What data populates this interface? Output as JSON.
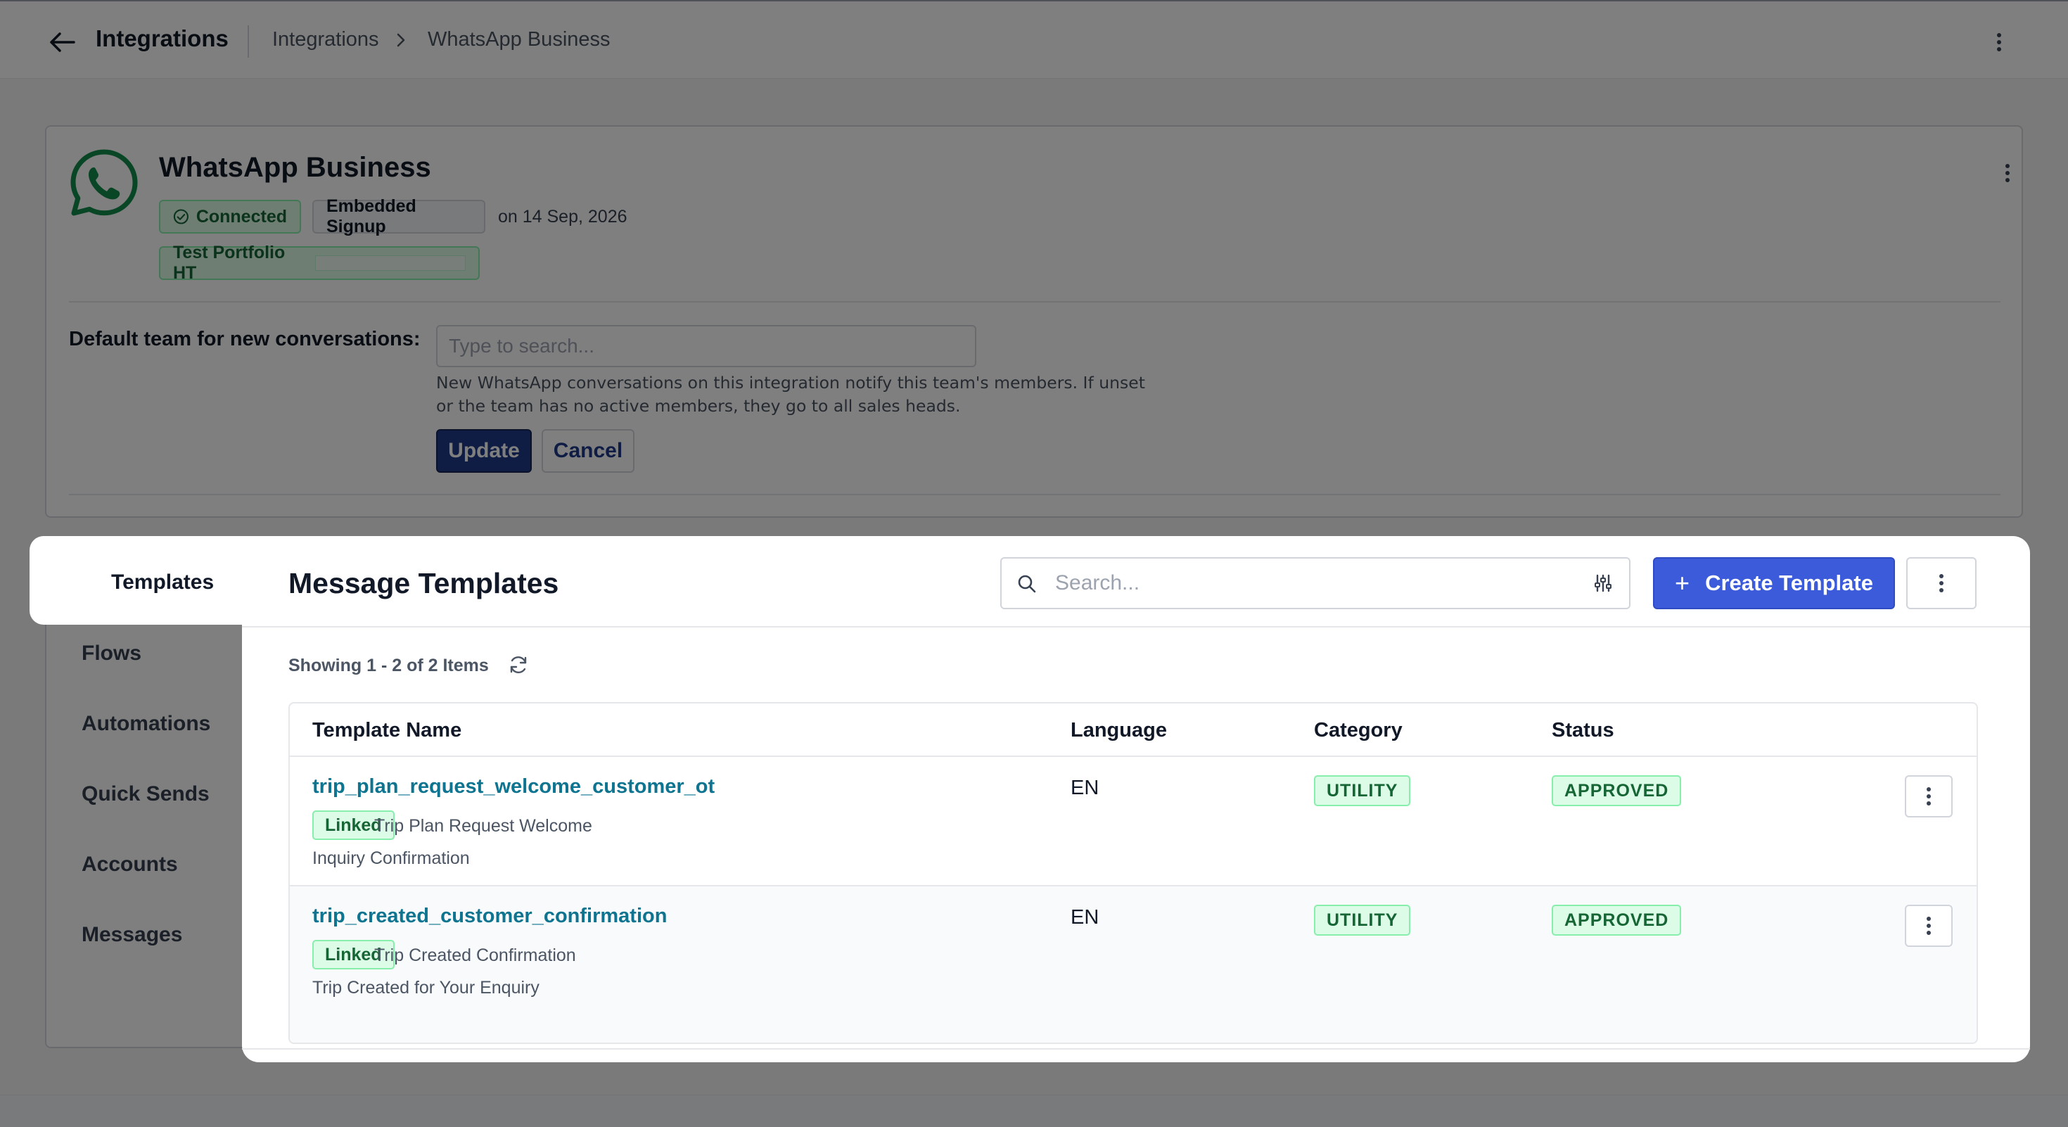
{
  "topbar": {
    "title": "Integrations",
    "breadcrumb": [
      "Integrations",
      "WhatsApp Business"
    ]
  },
  "integration": {
    "name": "WhatsApp Business",
    "status_badge": "Connected",
    "signup_badge": "Embedded Signup",
    "connected_date": "on 14 Sep, 2026",
    "portfolio_badge": "Test Portfolio HT",
    "default_team_label": "Default team for new conversations:",
    "team_search_placeholder": "Type to search...",
    "team_help_line1": "New WhatsApp conversations on this integration notify this team's members. If unset",
    "team_help_line2": "or the team has no active members, they go to all sales heads.",
    "update_label": "Update",
    "cancel_label": "Cancel"
  },
  "side_nav": {
    "items": [
      "Templates",
      "Flows",
      "Automations",
      "Quick Sends",
      "Accounts",
      "Messages"
    ],
    "active": "Templates"
  },
  "templates": {
    "title": "Message Templates",
    "search_placeholder": "Search...",
    "create_label": "Create Template",
    "showing_text": "Showing 1 - 2 of 2 Items",
    "columns": [
      "Template Name",
      "Language",
      "Category",
      "Status"
    ],
    "rows": [
      {
        "name": "trip_plan_request_welcome_customer_ot",
        "linked_label": "Linked",
        "friendly_name": "Trip Plan Request Welcome",
        "subtitle": "Inquiry Confirmation",
        "language": "EN",
        "category": "UTILITY",
        "status": "APPROVED"
      },
      {
        "name": "trip_created_customer_confirmation",
        "linked_label": "Linked",
        "friendly_name": "Trip Created Confirmation",
        "subtitle": "Trip Created for Your Enquiry",
        "language": "EN",
        "category": "UTILITY",
        "status": "APPROVED"
      }
    ]
  },
  "colors": {
    "accent": "#3b5bdb",
    "update_button": "#1e3a8a",
    "link": "#0e7490",
    "success_bg": "#dcfce7",
    "success_text": "#166534",
    "whatsapp": "#128c4a"
  },
  "icons": {
    "back": "arrow-left-icon",
    "breadcrumb_separator": "chevron-right-icon",
    "more": "vertical-dots-icon",
    "logo": "whatsapp-icon",
    "connected": "check-circle-icon",
    "search": "search-icon",
    "filter": "filter-sliders-icon",
    "create": "plus-icon",
    "refresh": "refresh-icon"
  }
}
